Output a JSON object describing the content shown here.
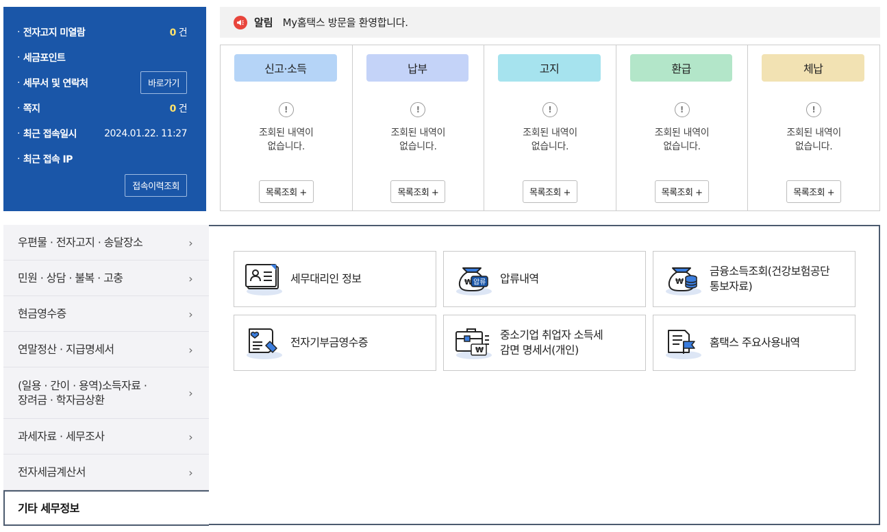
{
  "info_panel": {
    "unread_notice_label": "전자고지 미열람",
    "unread_notice_count": "0",
    "tax_points_label": "세금포인트",
    "tax_office_label": "세무서 및 연락처",
    "shortcut_button": "바로가기",
    "messages_label": "쪽지",
    "messages_count": "0",
    "count_unit": "건",
    "last_login_label": "최근 접속일시",
    "last_login_value": "2024.01.22.  11:27",
    "last_ip_label": "최근 접속 IP",
    "history_button": "접속이력조회",
    "bullet": "·"
  },
  "notice": {
    "label": "알림",
    "text": "My홈택스 방문을 환영합니다."
  },
  "status_columns": [
    {
      "title": "신고·소득",
      "color": "#b5d4f7",
      "alert": "!",
      "msg_line1": "조회된 내역이",
      "msg_line2": "없습니다.",
      "button": "목록조회 +"
    },
    {
      "title": "납부",
      "color": "#c4d3f8",
      "alert": "!",
      "msg_line1": "조회된 내역이",
      "msg_line2": "없습니다.",
      "button": "목록조회 +"
    },
    {
      "title": "고지",
      "color": "#a6e3ee",
      "alert": "!",
      "msg_line1": "조회된 내역이",
      "msg_line2": "없습니다.",
      "button": "목록조회 +"
    },
    {
      "title": "환급",
      "color": "#b3e6c9",
      "alert": "!",
      "msg_line1": "조회된 내역이",
      "msg_line2": "없습니다.",
      "button": "목록조회 +"
    },
    {
      "title": "체납",
      "color": "#f2e2b3",
      "alert": "!",
      "msg_line1": "조회된 내역이",
      "msg_line2": "없습니다.",
      "button": "목록조회 +"
    }
  ],
  "side_menu": {
    "chevron": "›",
    "items": [
      {
        "label": "우편물 · 전자고지 · 송달장소"
      },
      {
        "label": "민원 · 상담 · 불복 · 고충"
      },
      {
        "label": "현금영수증"
      },
      {
        "label": "연말정산 · 지급명세서"
      },
      {
        "label_line1": "(일용 · 간이 · 용역)소득자료 ·",
        "label_line2": "장려금 · 학자금상환"
      },
      {
        "label": "과세자료 · 세무조사"
      },
      {
        "label": "전자세금계산서"
      },
      {
        "label": "기타 세무정보"
      }
    ]
  },
  "tiles": [
    {
      "icon": "tax-agent-card-icon",
      "line1": "세무대리인 정보",
      "line2": ""
    },
    {
      "icon": "seizure-moneybag-icon",
      "line1": "압류내역",
      "line2": "",
      "icon_text": "압류",
      "won": "₩"
    },
    {
      "icon": "finance-moneybag-coins-icon",
      "line1": "금융소득조회(건강보험공단",
      "line2": "통보자료)",
      "won": "₩"
    },
    {
      "icon": "donation-receipt-icon",
      "line1": "전자기부금영수증",
      "line2": ""
    },
    {
      "icon": "briefcase-won-icon",
      "line1": "중소기업 취업자 소득세",
      "line2": "감면 명세서(개인)",
      "won": "₩"
    },
    {
      "icon": "document-flag-icon",
      "line1": "홈택스 주요사용내역",
      "line2": ""
    }
  ]
}
